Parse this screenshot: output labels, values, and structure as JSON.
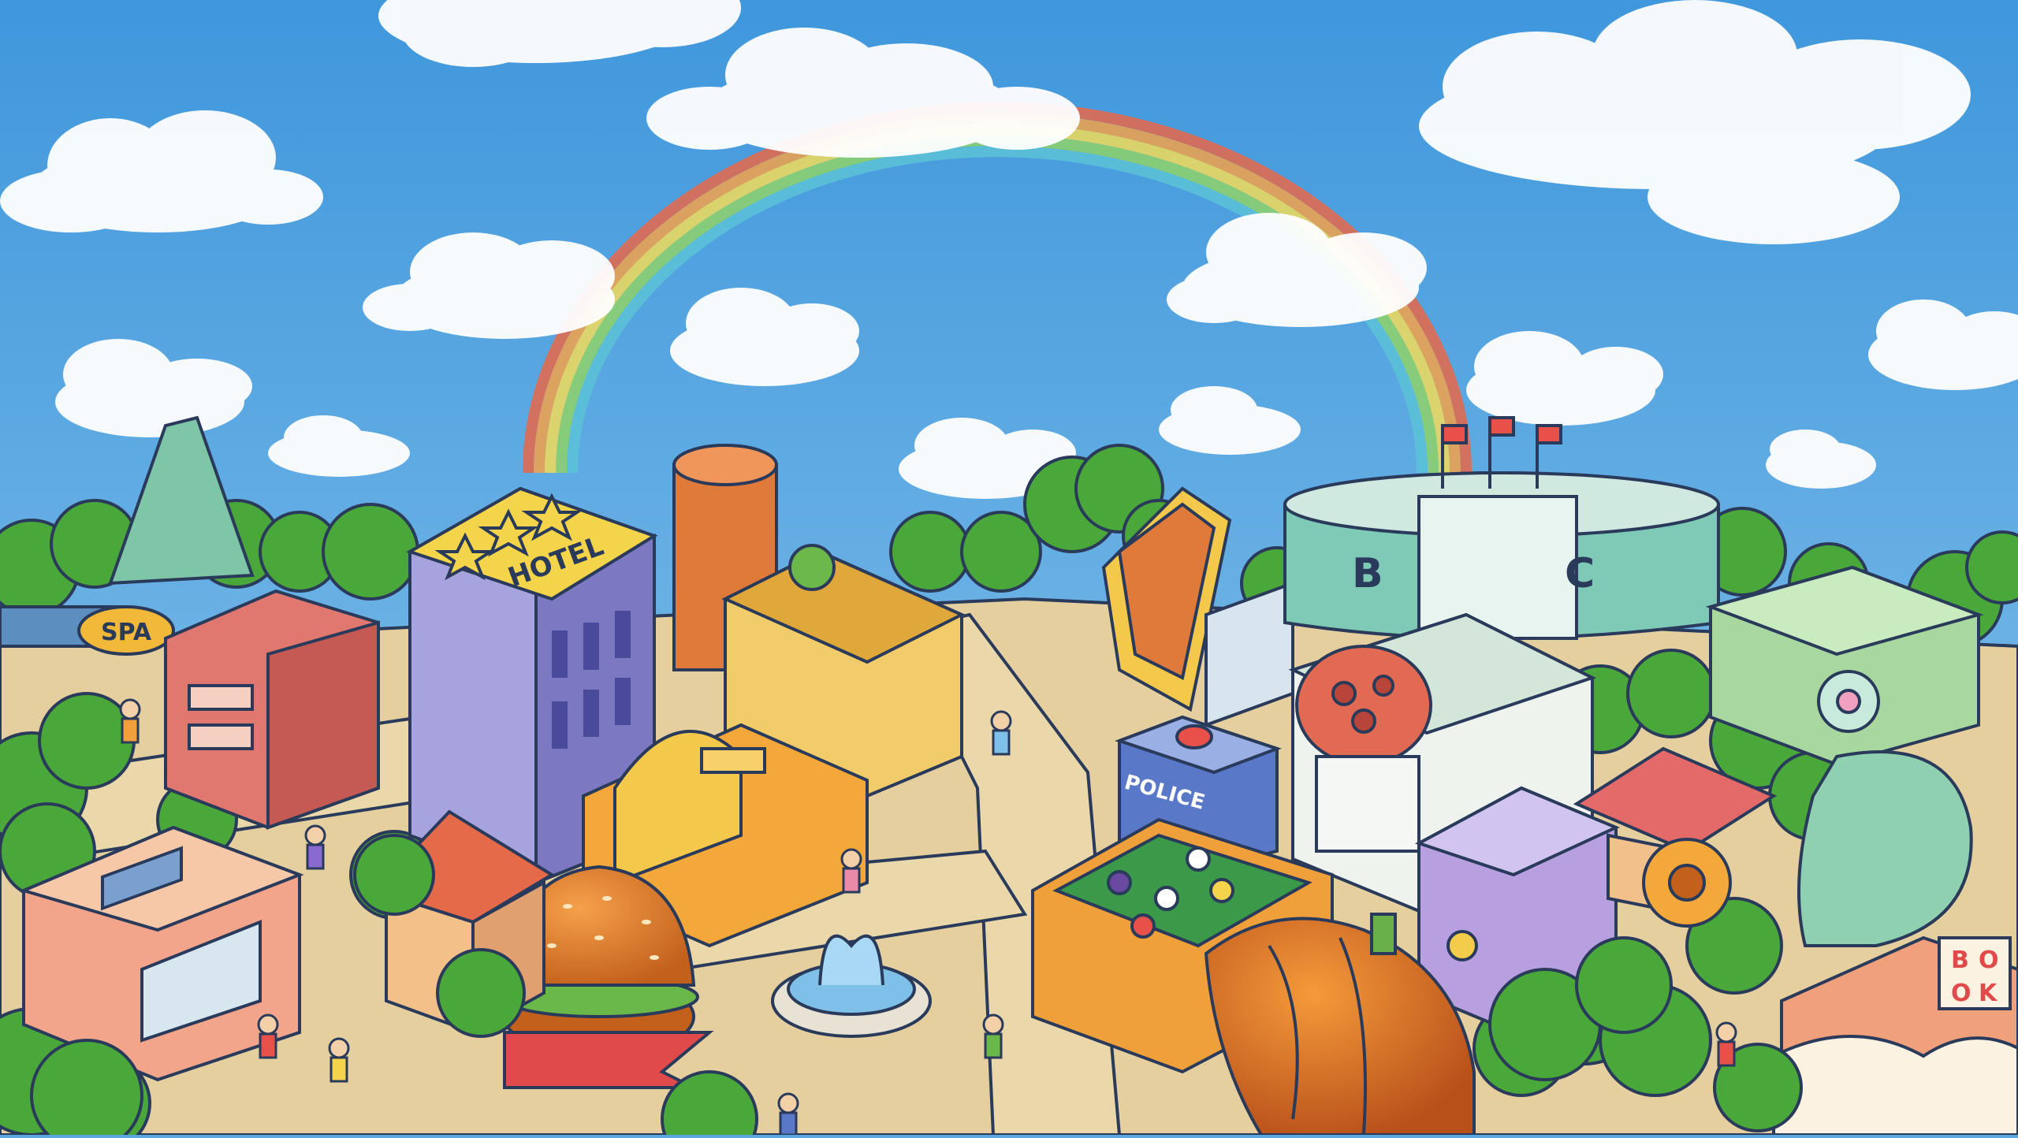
{
  "scene": {
    "description_kind": "isometric cartoon town illustration",
    "signs": {
      "hotel": "HOTEL",
      "spa": "SPA",
      "police": "POLICE",
      "stadium_left": "B",
      "stadium_right": "C",
      "book": [
        "B",
        "O",
        "O",
        "K"
      ]
    },
    "colors": {
      "sky": "#5aa6de",
      "road": "#e5cf9f",
      "tree": "#4aa83a",
      "outline": "#2a3a5a"
    }
  }
}
